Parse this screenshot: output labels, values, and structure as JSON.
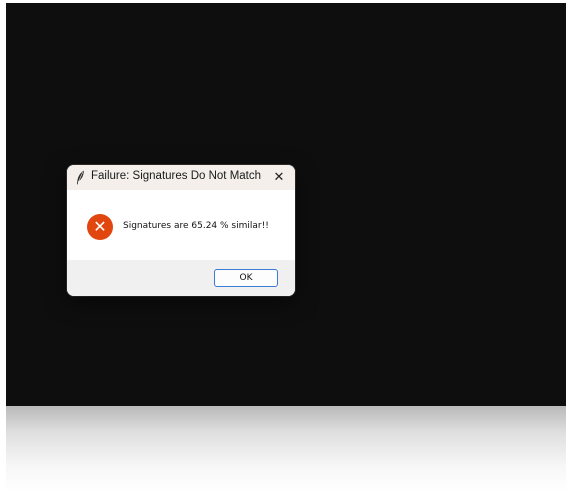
{
  "dialog": {
    "title": "Failure: Signatures Do Not Match",
    "close_glyph": "✕",
    "app_icon": "feather-icon",
    "status_icon": "error-icon",
    "status_glyph": "✕",
    "message": "Signatures are 65.24 % similar!!",
    "ok_label": "OK"
  },
  "colors": {
    "background_window": "#0e0e0e",
    "title_bar": "#f4efea",
    "error_red": "#e2460f",
    "button_border": "#3a7bd5"
  }
}
